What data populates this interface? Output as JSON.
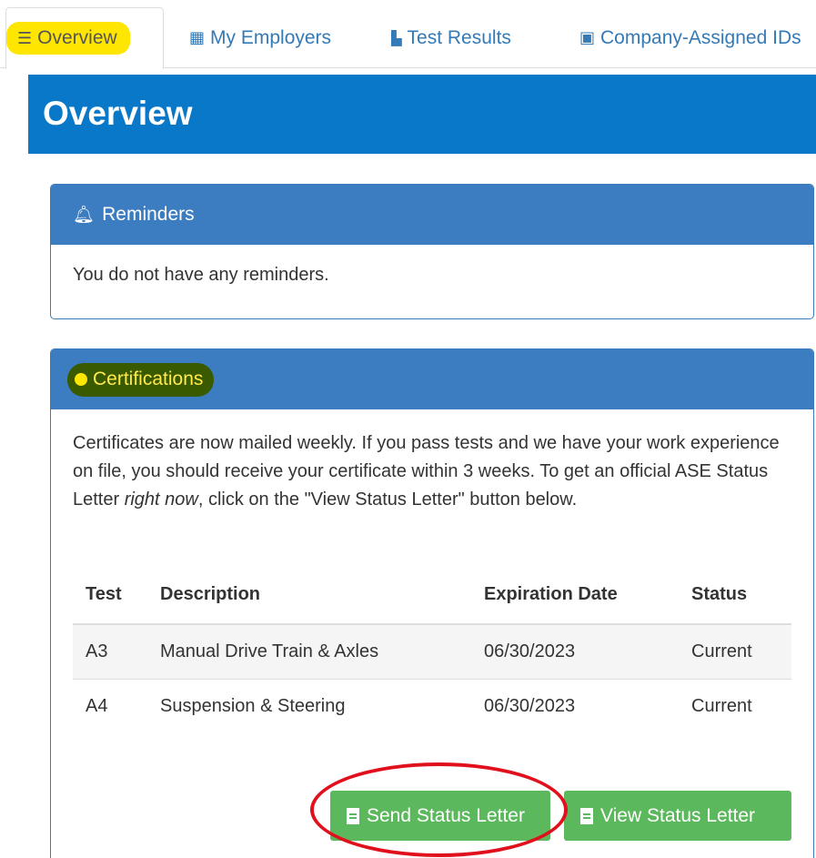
{
  "tabs": [
    {
      "label": "Overview",
      "icon": "list-icon"
    },
    {
      "label": "My Employers",
      "icon": "building-icon"
    },
    {
      "label": "Test Results",
      "icon": "bar-chart-icon"
    },
    {
      "label": "Company-Assigned IDs",
      "icon": "id-card-icon"
    }
  ],
  "banner": {
    "title": "Overview"
  },
  "reminders": {
    "heading": "Reminders",
    "message": "You do not have any reminders."
  },
  "certifications": {
    "heading": "Certifications",
    "intro_part1": "Certificates are now mailed weekly. If you pass tests and we have your work experience on file, you should receive your certificate within 3 weeks. To get an official ASE Status Letter ",
    "intro_italic": "right now",
    "intro_part2": ", click on the \"View Status Letter\" button below.",
    "columns": [
      "Test",
      "Description",
      "Expiration Date",
      "Status"
    ],
    "rows": [
      {
        "test": "A3",
        "description": "Manual Drive Train & Axles",
        "expiration": "06/30/2023",
        "status": "Current"
      },
      {
        "test": "A4",
        "description": "Suspension & Steering",
        "expiration": "06/30/2023",
        "status": "Current"
      }
    ],
    "send_button": "Send Status Letter",
    "view_button": "View Status Letter"
  },
  "colors": {
    "accent": "#0a78c8",
    "panel_heading": "#3b7dc0",
    "button_green": "#5cb85c",
    "highlight_yellow": "#ffe600",
    "annotation_red": "#e0101c"
  }
}
